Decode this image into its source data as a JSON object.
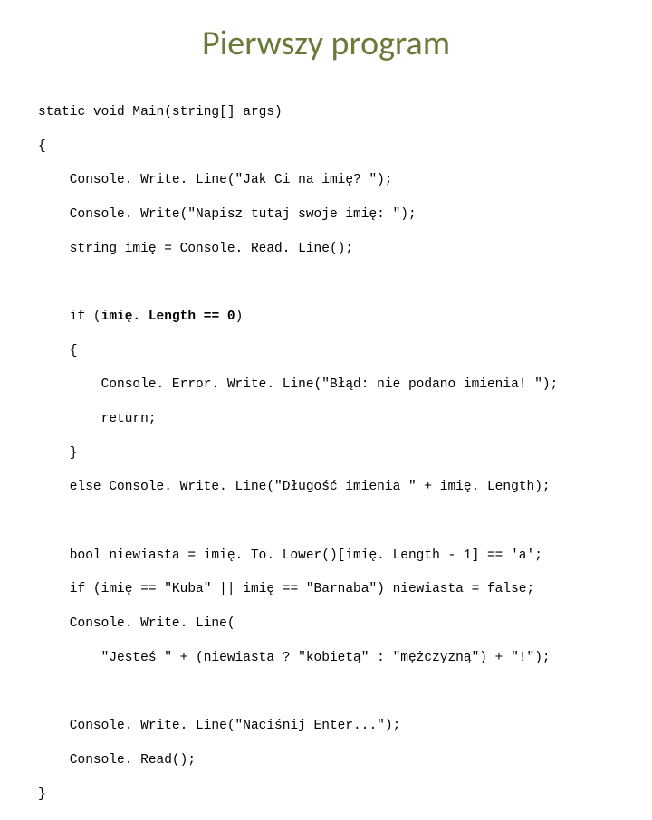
{
  "title": "Pierwszy program",
  "code": {
    "l1": "static void Main(string[] args)",
    "l2": "{",
    "l3": "    Console. Write. Line(\"Jak Ci na imię? \");",
    "l4": "    Console. Write(\"Napisz tutaj swoje imię: \");",
    "l5": "    string imię = Console. Read. Line();",
    "l6_pre": "    if (",
    "l6_bold": "imię. Length == 0",
    "l6_post": ")",
    "l7": "    {",
    "l8": "        Console. Error. Write. Line(\"Błąd: nie podano imienia! \");",
    "l9": "        return;",
    "l10": "    }",
    "l11": "    else Console. Write. Line(\"Długość imienia \" + imię. Length);",
    "l12": "    bool niewiasta = imię. To. Lower()[imię. Length - 1] == 'a';",
    "l13": "    if (imię == \"Kuba\" || imię == \"Barnaba\") niewiasta = false;",
    "l14": "    Console. Write. Line(",
    "l15": "        \"Jesteś \" + (niewiasta ? \"kobietą\" : \"mężczyzną\") + \"!\");",
    "l16": "    Console. Write. Line(\"Naciśnij Enter...\");",
    "l17": "    Console. Read();",
    "l18": "}"
  }
}
